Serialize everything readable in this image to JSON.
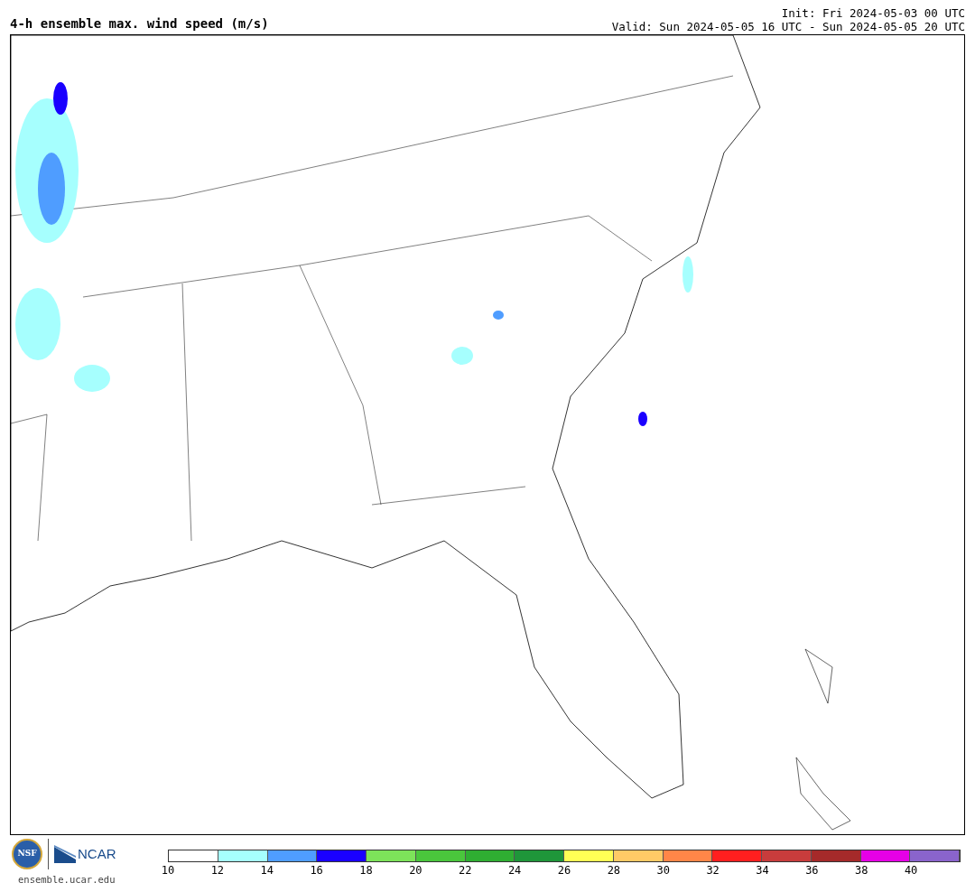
{
  "title": "4-h ensemble max. wind speed (m/s)",
  "init": "Init: Fri 2024-05-03 00 UTC",
  "valid": "Valid: Sun 2024-05-05 16 UTC - Sun 2024-05-05 20 UTC",
  "logos": {
    "nsf": "NSF",
    "ncar": "NCAR"
  },
  "website": "ensemble.ucar.edu",
  "legend": {
    "bins": [
      {
        "color": "#ffffff"
      },
      {
        "color": "#a6fffe"
      },
      {
        "color": "#4f9dff"
      },
      {
        "color": "#1a00ff"
      },
      {
        "color": "#7de35a"
      },
      {
        "color": "#4ac63c"
      },
      {
        "color": "#2fae32"
      },
      {
        "color": "#1f963a"
      },
      {
        "color": "#ffff55"
      },
      {
        "color": "#ffca66"
      },
      {
        "color": "#ff8648"
      },
      {
        "color": "#ff1f1f"
      },
      {
        "color": "#c83c3c"
      },
      {
        "color": "#a52a2a"
      },
      {
        "color": "#e600e6"
      },
      {
        "color": "#8a64cc"
      }
    ],
    "labels": [
      "10",
      "12",
      "14",
      "16",
      "18",
      "20",
      "22",
      "24",
      "26",
      "28",
      "30",
      "32",
      "34",
      "36",
      "38",
      "40"
    ]
  }
}
